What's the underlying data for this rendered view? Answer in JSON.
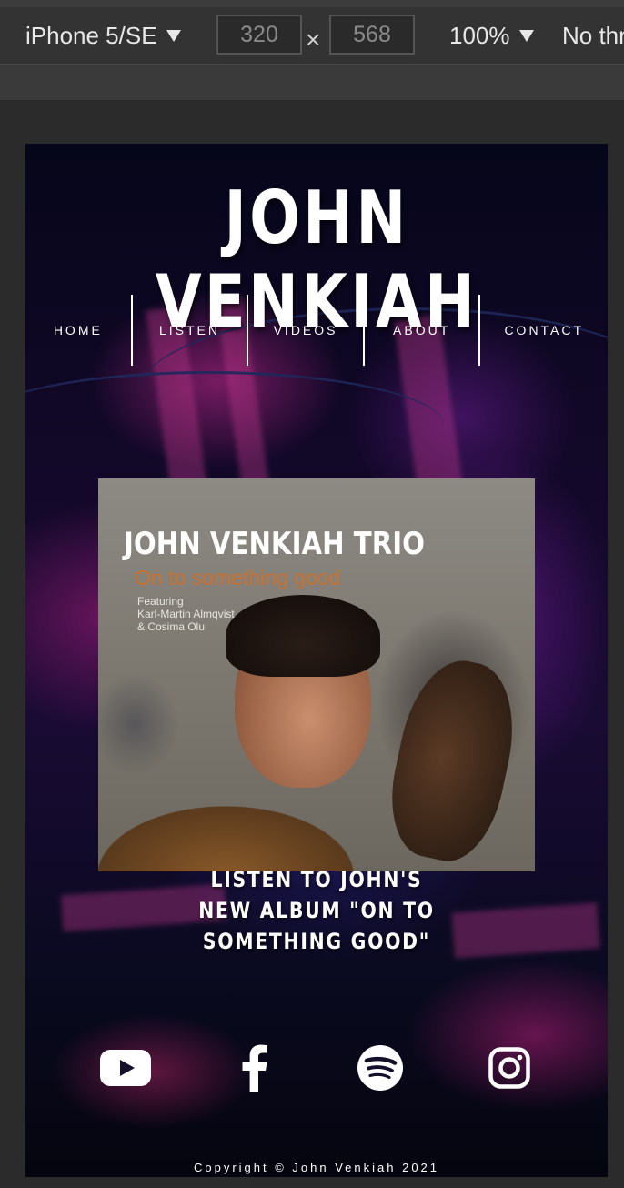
{
  "devtools": {
    "device": "iPhone 5/SE",
    "width": "320",
    "height": "568",
    "times": "×",
    "zoom": "100%",
    "throttle": "No thr"
  },
  "site": {
    "title": "JOHN VENKIAH",
    "nav": [
      "HOME",
      "LISTEN",
      "VIDEOS",
      "ABOUT",
      "CONTACT"
    ],
    "album": {
      "title": "JOHN VENKIAH TRIO",
      "subtitle": "On to something good",
      "featuring": "Featuring\nKarl-Martin Almqvist\n& Cosima Olu"
    },
    "caption": "LISTEN TO JOHN'S NEW ALBUM \"ON TO SOMETHING GOOD\"",
    "social": [
      "youtube-icon",
      "facebook-icon",
      "spotify-icon",
      "instagram-icon"
    ],
    "copyright": "Copyright © John Venkiah 2021"
  },
  "colors": {
    "text": "#ffffff",
    "album_subtitle": "#c9712e",
    "toolbar_bg": "#333333"
  }
}
